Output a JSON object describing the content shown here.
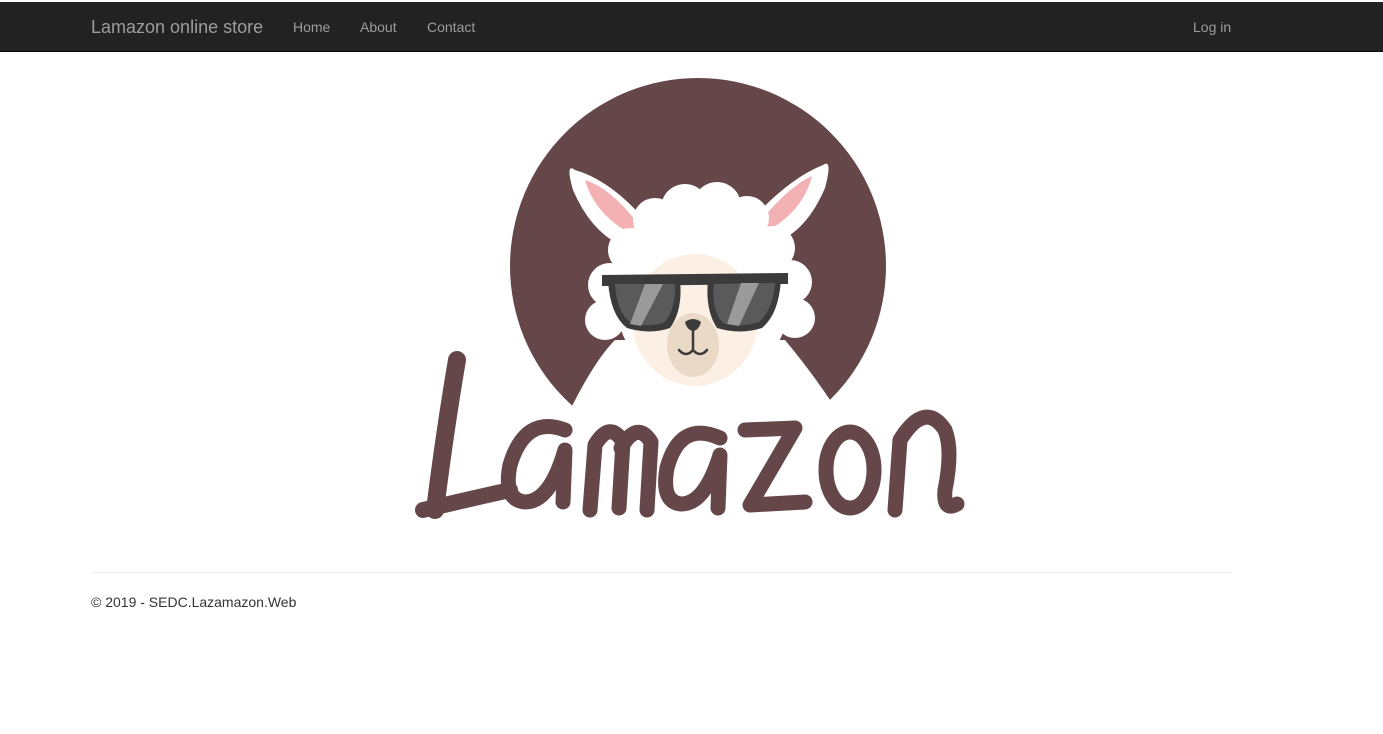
{
  "navbar": {
    "brand": "Lamazon online store",
    "links": [
      {
        "label": "Home"
      },
      {
        "label": "About"
      },
      {
        "label": "Contact"
      }
    ],
    "login_label": "Log in"
  },
  "hero": {
    "logo_wordmark": "Lamazon"
  },
  "footer": {
    "copyright": "© 2019 - SEDC.Lazamazon.Web"
  },
  "colors": {
    "navbar_bg": "#222222",
    "nav_text": "#9d9d9d",
    "logo_brown": "#654749",
    "ear_pink": "#f4b1b3",
    "glasses_dark": "#3b3b3b",
    "face_cream": "#fcefe4"
  }
}
